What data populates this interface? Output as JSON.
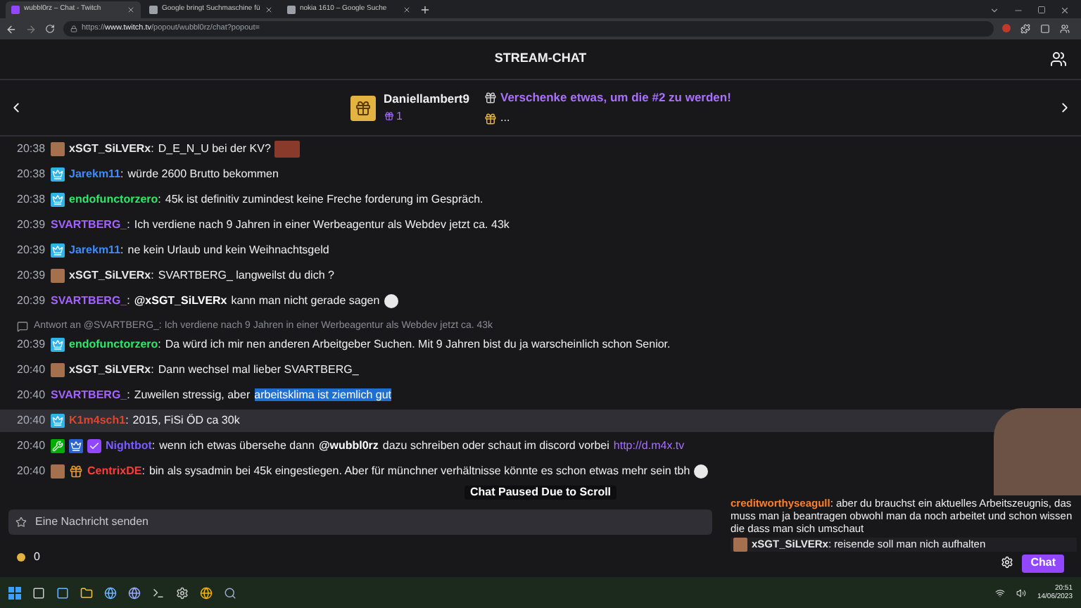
{
  "browser": {
    "tabs": [
      {
        "title": "wubbl0rz – Chat - Twitch",
        "selected": true
      },
      {
        "title": "Google bringt Suchmaschine fü",
        "selected": false
      },
      {
        "title": "nokia 1610 – Google Suche",
        "selected": false
      }
    ],
    "url": {
      "prefix": "https://",
      "domain": "www.twitch.tv",
      "path": "/popout/wubbl0rz/chat?popout="
    }
  },
  "header": {
    "title": "STREAM-CHAT"
  },
  "leaderboard": {
    "top": {
      "name": "Daniellambert9",
      "count": "1"
    },
    "next": {
      "text": "Verschenke etwas, um die #2 zu werden!",
      "more": "..."
    }
  },
  "messages": [
    {
      "time": "20:38",
      "badges": [
        {
          "kind": "avatar"
        }
      ],
      "name": "xSGT_SiLVERx",
      "sep": ":",
      "color": "#e6e6e6",
      "highlighted": false,
      "parts": [
        {
          "kind": "text",
          "text": "D_E_N_U bei der KV?"
        },
        {
          "kind": "emote"
        }
      ]
    },
    {
      "time": "20:38",
      "badges": [
        {
          "kind": "subscriber"
        }
      ],
      "name": "Jarekm11",
      "sep": ":",
      "color": "#3d8bff",
      "highlighted": false,
      "parts": [
        {
          "kind": "text",
          "text": "würde 2600 Brutto bekommen"
        }
      ]
    },
    {
      "time": "20:38",
      "badges": [
        {
          "kind": "subscriber"
        }
      ],
      "name": "endofunctorzero",
      "sep": ":",
      "color": "#2ee86a",
      "highlighted": false,
      "parts": [
        {
          "kind": "text",
          "text": "45k ist definitiv zumindest keine Freche forderung im Gespräch."
        }
      ]
    },
    {
      "time": "20:39",
      "name": "SVARTBERG_",
      "sep": ":",
      "color": "#a463ff",
      "highlighted": false,
      "parts": [
        {
          "kind": "text",
          "text": "Ich verdiene nach 9 Jahren in einer Werbeagentur als Webdev jetzt ca. 43k"
        }
      ]
    },
    {
      "time": "20:39",
      "badges": [
        {
          "kind": "subscriber"
        }
      ],
      "name": "Jarekm11",
      "sep": ":",
      "color": "#3d8bff",
      "highlighted": false,
      "parts": [
        {
          "kind": "text",
          "text": "ne kein Urlaub und kein Weihnachtsgeld"
        }
      ]
    },
    {
      "time": "20:39",
      "badges": [
        {
          "kind": "avatar"
        }
      ],
      "name": "xSGT_SiLVERx",
      "sep": ":",
      "color": "#e6e6e6",
      "highlighted": false,
      "parts": [
        {
          "kind": "text",
          "text": "SVARTBERG_ langweilst du dich ?"
        }
      ]
    },
    {
      "time": "20:39",
      "name": "SVARTBERG_",
      "sep": ":",
      "color": "#a463ff",
      "highlighted": false,
      "parts": [
        {
          "kind": "mention",
          "text": "@xSGT_SiLVERx"
        },
        {
          "kind": "text",
          "text": "kann man nicht gerade sagen"
        },
        {
          "kind": "emoji"
        }
      ]
    },
    {
      "time": "20:39",
      "badges": [
        {
          "kind": "subscriber"
        }
      ],
      "name": "endofunctorzero",
      "sep": ":",
      "color": "#2ee86a",
      "highlighted": false,
      "reply": "Antwort an @SVARTBERG_: Ich verdiene nach 9 Jahren in einer Werbeagentur als Webdev jetzt ca. 43k",
      "parts": [
        {
          "kind": "text",
          "text": "Da würd ich mir nen anderen Arbeitgeber Suchen. Mit 9 Jahren bist du ja warscheinlich schon Senior."
        }
      ]
    },
    {
      "time": "20:40",
      "badges": [
        {
          "kind": "avatar"
        }
      ],
      "name": "xSGT_SiLVERx",
      "sep": ":",
      "color": "#e6e6e6",
      "highlighted": false,
      "parts": [
        {
          "kind": "text",
          "text": "Dann wechsel mal lieber SVARTBERG_"
        }
      ]
    },
    {
      "time": "20:40",
      "name": "SVARTBERG_",
      "sep": ":",
      "color": "#a463ff",
      "highlighted": false,
      "parts": [
        {
          "kind": "text",
          "text": "Zuweilen stressig, aber"
        },
        {
          "kind": "selection",
          "text": "arbeitsklima ist ziemlich gut"
        }
      ]
    },
    {
      "time": "20:40",
      "badges": [
        {
          "kind": "subscriber"
        }
      ],
      "name": "K1m4sch1",
      "sep": ":",
      "color": "#e0452b",
      "highlighted": true,
      "parts": [
        {
          "kind": "text",
          "text": "2015, FiSi ÖD ca 30k"
        }
      ]
    },
    {
      "time": "20:40",
      "badges": [
        {
          "kind": "moderator"
        },
        {
          "kind": "partner"
        },
        {
          "kind": "verified"
        }
      ],
      "name": "Nightbot",
      "sep": ":",
      "color": "#7c5cff",
      "highlighted": false,
      "parts": [
        {
          "kind": "text",
          "text": "wenn ich etwas übersehe dann"
        },
        {
          "kind": "mention",
          "text": "@wubbl0rz"
        },
        {
          "kind": "text",
          "text": "dazu schreiben oder schaut im discord vorbei"
        },
        {
          "kind": "link",
          "text": "http://d.m4x.tv"
        }
      ]
    },
    {
      "time": "20:40",
      "badges": [
        {
          "kind": "avatar"
        },
        {
          "kind": "gifter"
        }
      ],
      "name": "CentrixDE",
      "sep": ":",
      "color": "#ff3b3b",
      "highlighted": false,
      "parts": [
        {
          "kind": "text",
          "text": "bin als sysadmin bei 45k eingestiegen. Aber für münchner verhältnisse könnte es schon etwas mehr sein tbh"
        },
        {
          "kind": "emoji"
        }
      ]
    }
  ],
  "paused": "Chat Paused Due to Scroll",
  "overlay": {
    "messages": [
      {
        "name": "creditworthyseagull",
        "sep": ":",
        "color": "#ff7f27",
        "text": "aber du brauchst ein aktuelles Arbeitszeugnis, das muss man ja beantragen obwohl man da noch arbeitet und schon wissen die dass man sich umschaut"
      },
      {
        "name": "xSGT_SiLVERx",
        "sep": ":",
        "color": "#e6e6e6",
        "badges": [
          {
            "kind": "avatar"
          }
        ],
        "text": "reisende soll man nich aufhalten"
      }
    ]
  },
  "input": {
    "placeholder": "Eine Nachricht senden"
  },
  "points": "0",
  "send": "Chat",
  "taskbar": {
    "time": "20:51",
    "date": "14/06/2023"
  }
}
